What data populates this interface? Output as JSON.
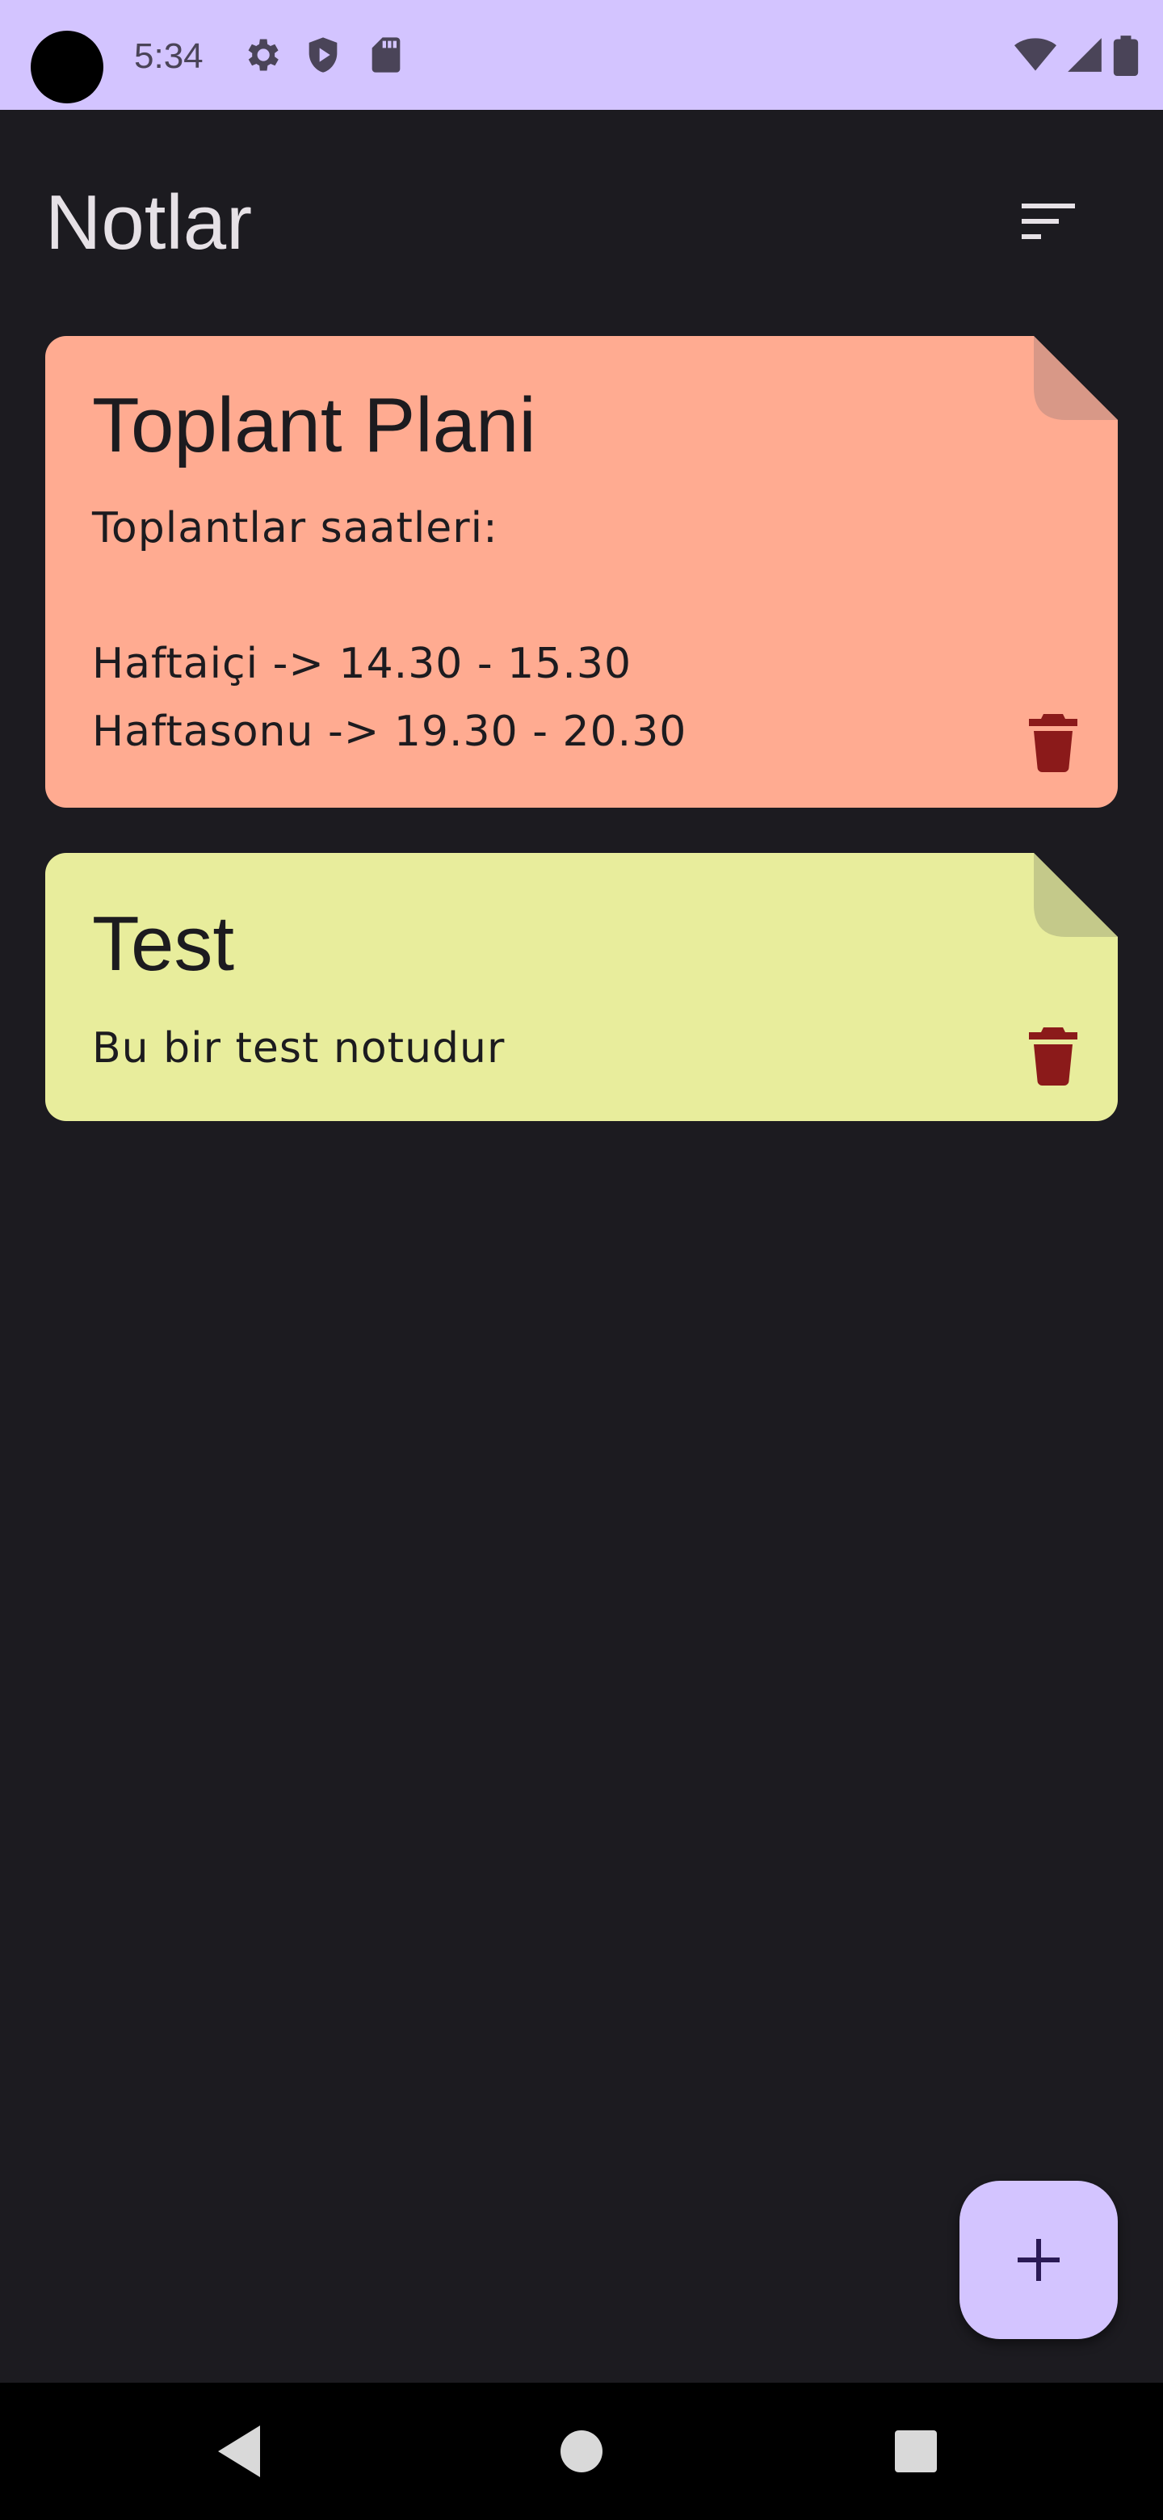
{
  "status_bar": {
    "time": "5:34",
    "icons": [
      "settings-icon",
      "shield-icon",
      "sd-card-icon",
      "wifi-icon",
      "signal-icon",
      "battery-icon"
    ],
    "background": "#d3c4ff"
  },
  "app_bar": {
    "title": "Notlar",
    "sort_icon": "sort-icon"
  },
  "notes": [
    {
      "title": "Toplant Plani",
      "content": "Toplantlar saatleri:\n\nHaftaiçi -> 14.30 - 15.30\nHaftasonu -> 19.30 - 20.30",
      "color": "#ffab91",
      "fold_color": "#d89887",
      "delete_icon": "trash-icon"
    },
    {
      "title": "Test",
      "content": "Bu bir test notudur",
      "color": "#e8ed9c",
      "fold_color": "#c4c98a",
      "delete_icon": "trash-icon"
    }
  ],
  "fab": {
    "icon": "plus-icon",
    "background": "#d3c4ff"
  },
  "nav_bar": {
    "buttons": [
      "back-icon",
      "home-icon",
      "recents-icon"
    ]
  },
  "colors": {
    "background": "#1c1b20",
    "delete": "#8b1a1a",
    "on_surface": "#e6e1e6"
  }
}
